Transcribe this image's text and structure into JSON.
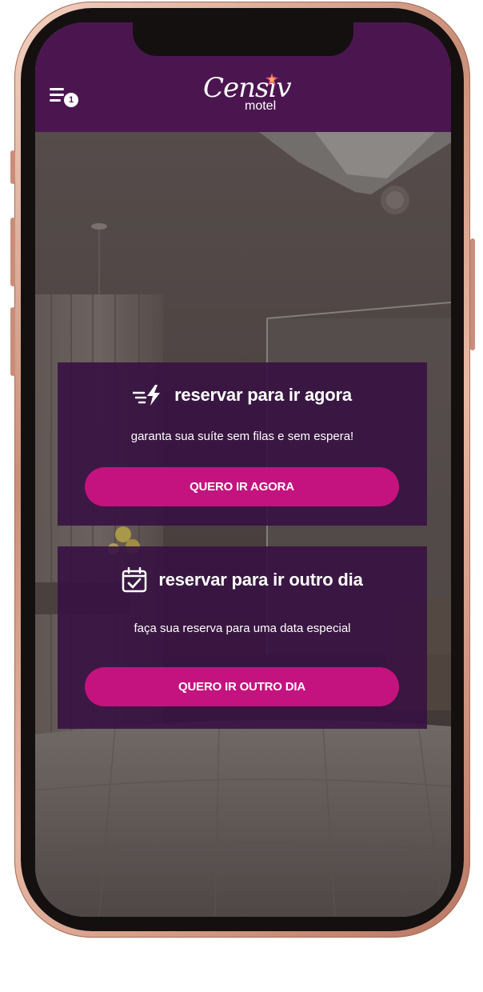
{
  "header": {
    "menu_badge": "1",
    "logo_text": "Censiv",
    "logo_sub": "motel"
  },
  "cards": [
    {
      "icon": "lightning-speed-icon",
      "title": "reservar para ir agora",
      "subtitle": "garanta sua suíte sem filas e sem espera!",
      "button": "QUERO IR AGORA"
    },
    {
      "icon": "calendar-check-icon",
      "title": "reservar para ir outro dia",
      "subtitle": "faça sua reserva para uma data especial",
      "button": "QUERO IR OUTRO DIA"
    }
  ],
  "colors": {
    "header_bg": "#4b1650",
    "card_bg": "#37124199",
    "button_bg": "#c4127f",
    "frame_accent": "#c98f78"
  }
}
